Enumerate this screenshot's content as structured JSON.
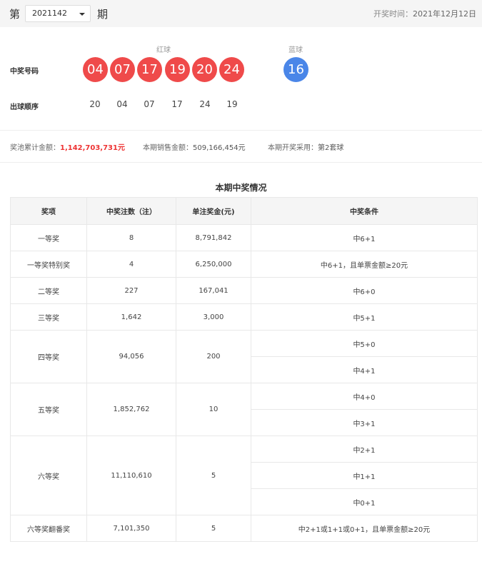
{
  "header": {
    "prefix": "第",
    "issue": "2021142",
    "suffix": "期",
    "draw_time_label": "开奖时间：",
    "draw_time_value": "2021年12月12日"
  },
  "numbers": {
    "row_label": "中奖号码",
    "red_label": "红球",
    "blue_label": "蓝球",
    "red": [
      "04",
      "07",
      "17",
      "19",
      "20",
      "24"
    ],
    "blue": "16",
    "red_color": "#ef4a4a",
    "blue_color": "#4a86e8"
  },
  "order": {
    "row_label": "出球顺序",
    "values": [
      "20",
      "04",
      "07",
      "17",
      "24",
      "19"
    ]
  },
  "stats": {
    "pool_label": "奖池累计金额：",
    "pool_value": "1,142,703,731元",
    "sales_label": "本期销售金额：",
    "sales_value": "509,166,454元",
    "machine_label": "本期开奖采用：",
    "machine_value": "第2套球"
  },
  "prize_table": {
    "title": "本期中奖情况",
    "headers": [
      "奖项",
      "中奖注数（注）",
      "单注奖金(元)",
      "中奖条件"
    ],
    "rows": [
      {
        "name": "一等奖",
        "count": "8",
        "amount": "8,791,842",
        "conditions": [
          "中6+1"
        ]
      },
      {
        "name": "一等奖特别奖",
        "count": "4",
        "amount": "6,250,000",
        "conditions": [
          "中6+1，且单票金额≥20元"
        ]
      },
      {
        "name": "二等奖",
        "count": "227",
        "amount": "167,041",
        "conditions": [
          "中6+0"
        ]
      },
      {
        "name": "三等奖",
        "count": "1,642",
        "amount": "3,000",
        "conditions": [
          "中5+1"
        ]
      },
      {
        "name": "四等奖",
        "count": "94,056",
        "amount": "200",
        "conditions": [
          "中5+0",
          "中4+1"
        ]
      },
      {
        "name": "五等奖",
        "count": "1,852,762",
        "amount": "10",
        "conditions": [
          "中4+0",
          "中3+1"
        ]
      },
      {
        "name": "六等奖",
        "count": "11,110,610",
        "amount": "5",
        "conditions": [
          "中2+1",
          "中1+1",
          "中0+1"
        ]
      },
      {
        "name": "六等奖翻番奖",
        "count": "7,101,350",
        "amount": "5",
        "conditions": [
          "中2+1或1+1或0+1，且单票金额≥20元"
        ]
      }
    ]
  }
}
